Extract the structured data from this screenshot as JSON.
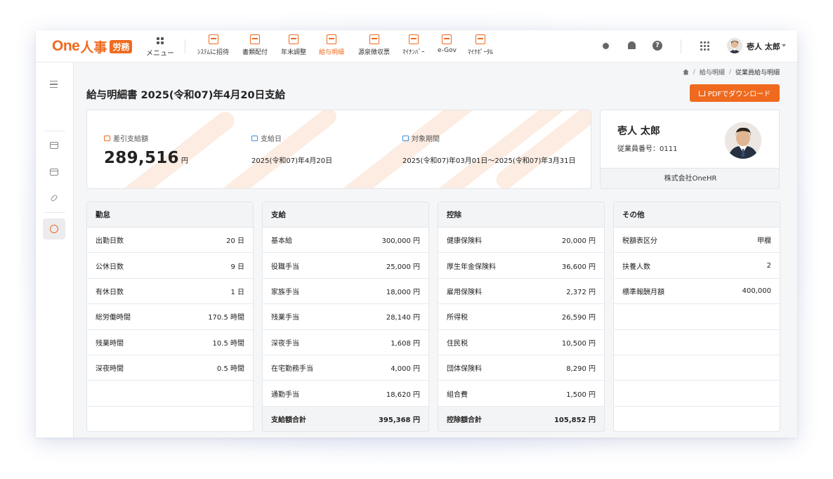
{
  "app": {
    "logo_one": "One",
    "logo_jinji": "人事",
    "logo_badge": "労務",
    "menu_label": "メニュー",
    "nav": [
      {
        "label": "ｼｽﾃﾑに招待",
        "icon": "invite-icon"
      },
      {
        "label": "書類配付",
        "icon": "document-distribute-icon"
      },
      {
        "label": "年末調整",
        "icon": "year-end-adjustment-icon"
      },
      {
        "label": "給与明細",
        "icon": "payslip-icon",
        "active": true
      },
      {
        "label": "源泉徴収票",
        "icon": "withholding-slip-icon"
      },
      {
        "label": "ﾏｲﾅﾝﾊﾞｰ",
        "icon": "my-number-icon"
      },
      {
        "label": "e-Gov",
        "icon": "egov-icon"
      },
      {
        "label": "ﾏｲﾅﾎﾟｰﾀﾙ",
        "icon": "myna-portal-icon"
      }
    ],
    "user_name": "壱人 太郎",
    "accent": "#ef6a1e"
  },
  "breadcrumb": {
    "home_icon": "home-icon",
    "items": [
      "給与明細",
      "従業員給与明細"
    ]
  },
  "page": {
    "title": "給与明細書 2025(令和07)年4月20日支給",
    "pdf_button": "PDFでダウンロード"
  },
  "summary": {
    "net_pay_label": "差引支給額",
    "net_pay_value": "289,516",
    "net_pay_unit": "円",
    "pay_date_label": "支給日",
    "pay_date_value": "2025(令和07)年4月20日",
    "period_label": "対象期間",
    "period_value": "2025(令和07)年03月01日〜2025(令和07)年3月31日"
  },
  "employee": {
    "name": "壱人 太郎",
    "number": "従業員番号：0111",
    "company": "株式会社OneHR"
  },
  "panels": {
    "attendance": {
      "title": "勤怠",
      "rows": [
        {
          "label": "出勤日数",
          "value": "20 日"
        },
        {
          "label": "公休日数",
          "value": "9 日"
        },
        {
          "label": "有休日数",
          "value": "1 日"
        },
        {
          "label": "総労働時間",
          "value": "170.5 時間"
        },
        {
          "label": "残業時間",
          "value": "10.5 時間"
        },
        {
          "label": "深夜時間",
          "value": "0.5 時間"
        }
      ]
    },
    "payments": {
      "title": "支給",
      "rows": [
        {
          "label": "基本給",
          "value": "300,000 円"
        },
        {
          "label": "役職手当",
          "value": "25,000 円"
        },
        {
          "label": "家族手当",
          "value": "18,000 円"
        },
        {
          "label": "残業手当",
          "value": "28,140 円"
        },
        {
          "label": "深夜手当",
          "value": "1,608 円"
        },
        {
          "label": "在宅勤務手当",
          "value": "4,000 円"
        },
        {
          "label": "通勤手当",
          "value": "18,620 円"
        }
      ],
      "total_label": "支給額合計",
      "total_value": "395,368 円"
    },
    "deductions": {
      "title": "控除",
      "rows": [
        {
          "label": "健康保険料",
          "value": "20,000 円"
        },
        {
          "label": "厚生年金保険料",
          "value": "36,600 円"
        },
        {
          "label": "雇用保険料",
          "value": "2,372 円"
        },
        {
          "label": "所得税",
          "value": "26,590 円"
        },
        {
          "label": "住民税",
          "value": "10,500 円"
        },
        {
          "label": "団体保険料",
          "value": "8,290 円"
        },
        {
          "label": "組合費",
          "value": "1,500 円"
        }
      ],
      "total_label": "控除額合計",
      "total_value": "105,852 円"
    },
    "other": {
      "title": "その他",
      "rows": [
        {
          "label": "税額表区分",
          "value": "甲欄"
        },
        {
          "label": "扶養人数",
          "value": "2"
        },
        {
          "label": "標準報酬月額",
          "value": "400,000"
        }
      ]
    }
  }
}
